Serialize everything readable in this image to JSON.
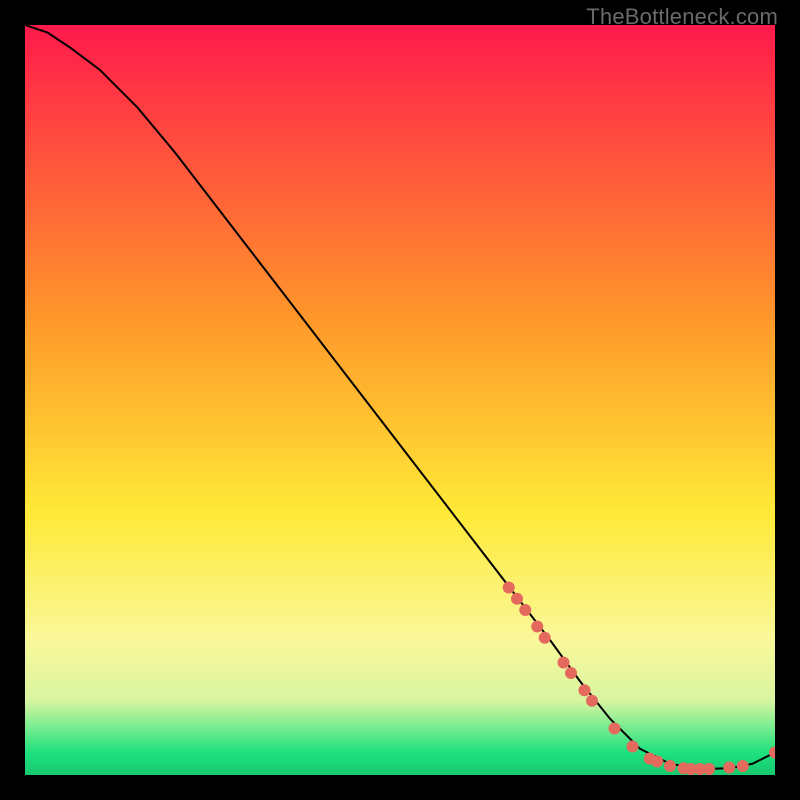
{
  "watermark": "TheBottleneck.com",
  "chart_data": {
    "type": "line",
    "title": "",
    "xlabel": "",
    "ylabel": "",
    "xlim": [
      0,
      100
    ],
    "ylim": [
      0,
      100
    ],
    "background_gradient": {
      "stops": [
        {
          "offset": 0,
          "color": "#ff1a4b"
        },
        {
          "offset": 40,
          "color": "#ff9a2a"
        },
        {
          "offset": 65,
          "color": "#ffe937"
        },
        {
          "offset": 82,
          "color": "#faf89a"
        },
        {
          "offset": 90,
          "color": "#d9f5a0"
        },
        {
          "offset": 97,
          "color": "#1ee27f"
        },
        {
          "offset": 100,
          "color": "#17c96f"
        }
      ]
    },
    "series": [
      {
        "name": "curve",
        "type": "line",
        "color": "#000000",
        "x": [
          0,
          3,
          6,
          10,
          15,
          20,
          25,
          30,
          35,
          40,
          45,
          50,
          55,
          60,
          65,
          70,
          74,
          78,
          82,
          86,
          90,
          94,
          97,
          100
        ],
        "y": [
          100,
          99,
          97,
          94,
          89,
          83,
          76.5,
          70,
          63.5,
          57,
          50.5,
          44,
          37.5,
          31,
          24.5,
          18,
          12.5,
          7.5,
          3.5,
          1.5,
          0.8,
          0.9,
          1.5,
          3
        ]
      },
      {
        "name": "markers",
        "type": "scatter",
        "color": "#e46a5e",
        "radius": 6,
        "points": [
          {
            "x": 64.5,
            "y": 25
          },
          {
            "x": 65.6,
            "y": 23.5
          },
          {
            "x": 66.7,
            "y": 22
          },
          {
            "x": 68.3,
            "y": 19.8
          },
          {
            "x": 69.3,
            "y": 18.3
          },
          {
            "x": 71.8,
            "y": 15
          },
          {
            "x": 72.8,
            "y": 13.6
          },
          {
            "x": 74.6,
            "y": 11.3
          },
          {
            "x": 75.6,
            "y": 9.9
          },
          {
            "x": 78.6,
            "y": 6.2
          },
          {
            "x": 81.0,
            "y": 3.8
          },
          {
            "x": 83.3,
            "y": 2.2
          },
          {
            "x": 84.3,
            "y": 1.8
          },
          {
            "x": 86.0,
            "y": 1.2
          },
          {
            "x": 87.8,
            "y": 0.9
          },
          {
            "x": 88.8,
            "y": 0.8
          },
          {
            "x": 90.0,
            "y": 0.8
          },
          {
            "x": 91.2,
            "y": 0.8
          },
          {
            "x": 93.9,
            "y": 1.0
          },
          {
            "x": 95.7,
            "y": 1.2
          },
          {
            "x": 100.0,
            "y": 3.0
          }
        ]
      }
    ]
  }
}
